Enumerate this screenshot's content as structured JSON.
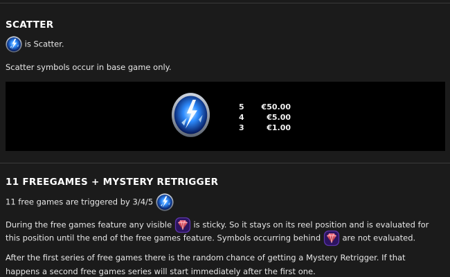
{
  "scatter_section": {
    "title": "SCATTER",
    "is_scatter_text": "is Scatter.",
    "base_game_text": "Scatter symbols occur in base game only.",
    "paytable": [
      {
        "count": "5",
        "value": "€50.00"
      },
      {
        "count": "4",
        "value": "€5.00"
      },
      {
        "count": "3",
        "value": "€1.00"
      }
    ]
  },
  "freegames_section": {
    "title": "11 FREEGAMES + MYSTERY RETRIGGER",
    "trigger_text": "11 free games are triggered by 3/4/5",
    "sticky_line1_a": "During the free games feature any visible",
    "sticky_line1_b": "is sticky. So it stays on its reel position and is evaluated for",
    "sticky_line2_a": "this position until the end of the free games feature. Symbols occurring behind",
    "sticky_line2_b": "are not evaluated.",
    "retrigger_line1": "After the first series of free games there is the random chance of getting a Mystery Retrigger. If that",
    "retrigger_line2": "happens a second free games series will start immediately after the first one."
  },
  "colors": {
    "background": "#1b1b1b",
    "panel": "#000000",
    "scatter_blue": "#2f8dff",
    "gem_red": "#d8213a"
  },
  "icons": {
    "scatter": "lightning-scatter-icon",
    "gem": "ruby-gem-icon"
  }
}
